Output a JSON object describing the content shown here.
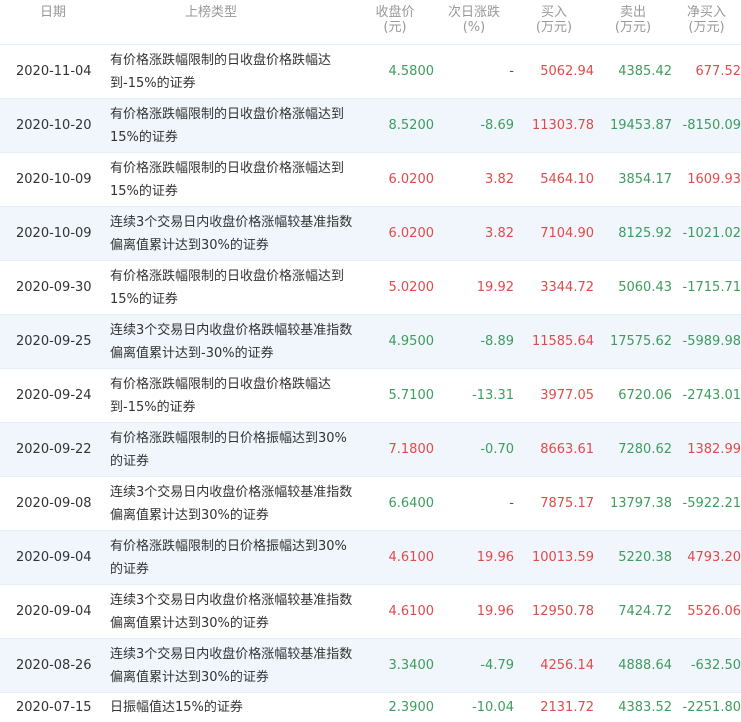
{
  "header": {
    "date": "日期",
    "type": "上榜类型",
    "close": "收盘价\n(元)",
    "next": "次日涨跌\n(%)",
    "buy": "买入\n(万元)",
    "sell": "卖出\n(万元)",
    "net": "净买入\n(万元)"
  },
  "colors": {
    "green": "#3f9c5f",
    "red": "#e04b4b",
    "stripe": "#f1f6fc"
  },
  "rows": [
    {
      "date": "2020-11-04",
      "type": "有价格涨跌幅限制的日收盘价格跌幅达到-15%的证券",
      "close": "4.5800",
      "next": "-",
      "buy": "5062.94",
      "sell": "4385.42",
      "net": "677.52",
      "close_color": "green",
      "next_color": "gray",
      "net_color": "red"
    },
    {
      "date": "2020-10-20",
      "type": "有价格涨跌幅限制的日收盘价格涨幅达到15%的证券",
      "close": "8.5200",
      "next": "-8.69",
      "buy": "11303.78",
      "sell": "19453.87",
      "net": "-8150.09",
      "close_color": "green",
      "next_color": "green",
      "net_color": "green"
    },
    {
      "date": "2020-10-09",
      "type": "有价格涨跌幅限制的日收盘价格涨幅达到15%的证券",
      "close": "6.0200",
      "next": "3.82",
      "buy": "5464.10",
      "sell": "3854.17",
      "net": "1609.93",
      "close_color": "red",
      "next_color": "red",
      "net_color": "red"
    },
    {
      "date": "2020-10-09",
      "type": "连续3个交易日内收盘价格涨幅较基准指数偏离值累计达到30%的证券",
      "close": "6.0200",
      "next": "3.82",
      "buy": "7104.90",
      "sell": "8125.92",
      "net": "-1021.02",
      "close_color": "red",
      "next_color": "red",
      "net_color": "green"
    },
    {
      "date": "2020-09-30",
      "type": "有价格涨跌幅限制的日收盘价格涨幅达到15%的证券",
      "close": "5.0200",
      "next": "19.92",
      "buy": "3344.72",
      "sell": "5060.43",
      "net": "-1715.71",
      "close_color": "red",
      "next_color": "red",
      "net_color": "green"
    },
    {
      "date": "2020-09-25",
      "type": "连续3个交易日内收盘价格跌幅较基准指数偏离值累计达到-30%的证券",
      "close": "4.9500",
      "next": "-8.89",
      "buy": "11585.64",
      "sell": "17575.62",
      "net": "-5989.98",
      "close_color": "green",
      "next_color": "green",
      "net_color": "green"
    },
    {
      "date": "2020-09-24",
      "type": "有价格涨跌幅限制的日收盘价格跌幅达到-15%的证券",
      "close": "5.7100",
      "next": "-13.31",
      "buy": "3977.05",
      "sell": "6720.06",
      "net": "-2743.01",
      "close_color": "green",
      "next_color": "green",
      "net_color": "green"
    },
    {
      "date": "2020-09-22",
      "type": "有价格涨跌幅限制的日价格振幅达到30%的证券",
      "close": "7.1800",
      "next": "-0.70",
      "buy": "8663.61",
      "sell": "7280.62",
      "net": "1382.99",
      "close_color": "red",
      "next_color": "green",
      "net_color": "red"
    },
    {
      "date": "2020-09-08",
      "type": "连续3个交易日内收盘价格涨幅较基准指数偏离值累计达到30%的证券",
      "close": "6.6400",
      "next": "-",
      "buy": "7875.17",
      "sell": "13797.38",
      "net": "-5922.21",
      "close_color": "green",
      "next_color": "gray",
      "net_color": "green"
    },
    {
      "date": "2020-09-04",
      "type": "有价格涨跌幅限制的日价格振幅达到30%的证券",
      "close": "4.6100",
      "next": "19.96",
      "buy": "10013.59",
      "sell": "5220.38",
      "net": "4793.20",
      "close_color": "red",
      "next_color": "red",
      "net_color": "red"
    },
    {
      "date": "2020-09-04",
      "type": "连续3个交易日内收盘价格涨幅较基准指数偏离值累计达到30%的证券",
      "close": "4.6100",
      "next": "19.96",
      "buy": "12950.78",
      "sell": "7424.72",
      "net": "5526.06",
      "close_color": "red",
      "next_color": "red",
      "net_color": "red"
    },
    {
      "date": "2020-08-26",
      "type": "连续3个交易日内收盘价格涨幅较基准指数偏离值累计达到30%的证券",
      "close": "3.3400",
      "next": "-4.79",
      "buy": "4256.14",
      "sell": "4888.64",
      "net": "-632.50",
      "close_color": "green",
      "next_color": "green",
      "net_color": "green"
    },
    {
      "date": "2020-07-15",
      "type": "日振幅值达15%的证券",
      "close": "2.3900",
      "next": "-10.04",
      "buy": "2131.72",
      "sell": "4383.52",
      "net": "-2251.80",
      "close_color": "green",
      "next_color": "green",
      "net_color": "green"
    }
  ]
}
